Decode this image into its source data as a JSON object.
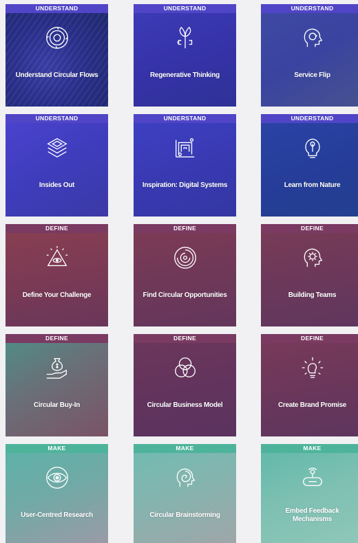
{
  "phases": {
    "understand": "UNDERSTAND",
    "define": "DEFINE",
    "make": "MAKE"
  },
  "cards": [
    {
      "phase": "UNDERSTAND",
      "title": "Understand Circular Flows",
      "icon": "circular-flow-icon"
    },
    {
      "phase": "UNDERSTAND",
      "title": "Regenerative Thinking",
      "icon": "plant-plug-icon"
    },
    {
      "phase": "UNDERSTAND",
      "title": "Service Flip",
      "icon": "head-cycle-icon"
    },
    {
      "phase": "UNDERSTAND",
      "title": "Insides Out",
      "icon": "layers-icon"
    },
    {
      "phase": "UNDERSTAND",
      "title": "Inspiration: Digital Systems",
      "icon": "circuit-icon"
    },
    {
      "phase": "UNDERSTAND",
      "title": "Learn from Nature",
      "icon": "leaf-bulb-icon"
    },
    {
      "phase": "DEFINE",
      "title": "Define Your Challenge",
      "icon": "pyramid-eye-icon"
    },
    {
      "phase": "DEFINE",
      "title": "Find Circular Opportunities",
      "icon": "maze-icon"
    },
    {
      "phase": "DEFINE",
      "title": "Building Teams",
      "icon": "head-gear-icon"
    },
    {
      "phase": "DEFINE",
      "title": "Circular Buy-In",
      "icon": "money-hand-icon"
    },
    {
      "phase": "DEFINE",
      "title": "Circular Business Model",
      "icon": "venn-icon"
    },
    {
      "phase": "DEFINE",
      "title": "Create Brand Promise",
      "icon": "bulb-spark-icon"
    },
    {
      "phase": "MAKE",
      "title": "User-Centred Research",
      "icon": "eye-icon"
    },
    {
      "phase": "MAKE",
      "title": "Circular Brainstorming",
      "icon": "brain-head-icon"
    },
    {
      "phase": "MAKE",
      "title": "Embed Feedback Mechanisms",
      "icon": "feedback-device-icon"
    }
  ]
}
